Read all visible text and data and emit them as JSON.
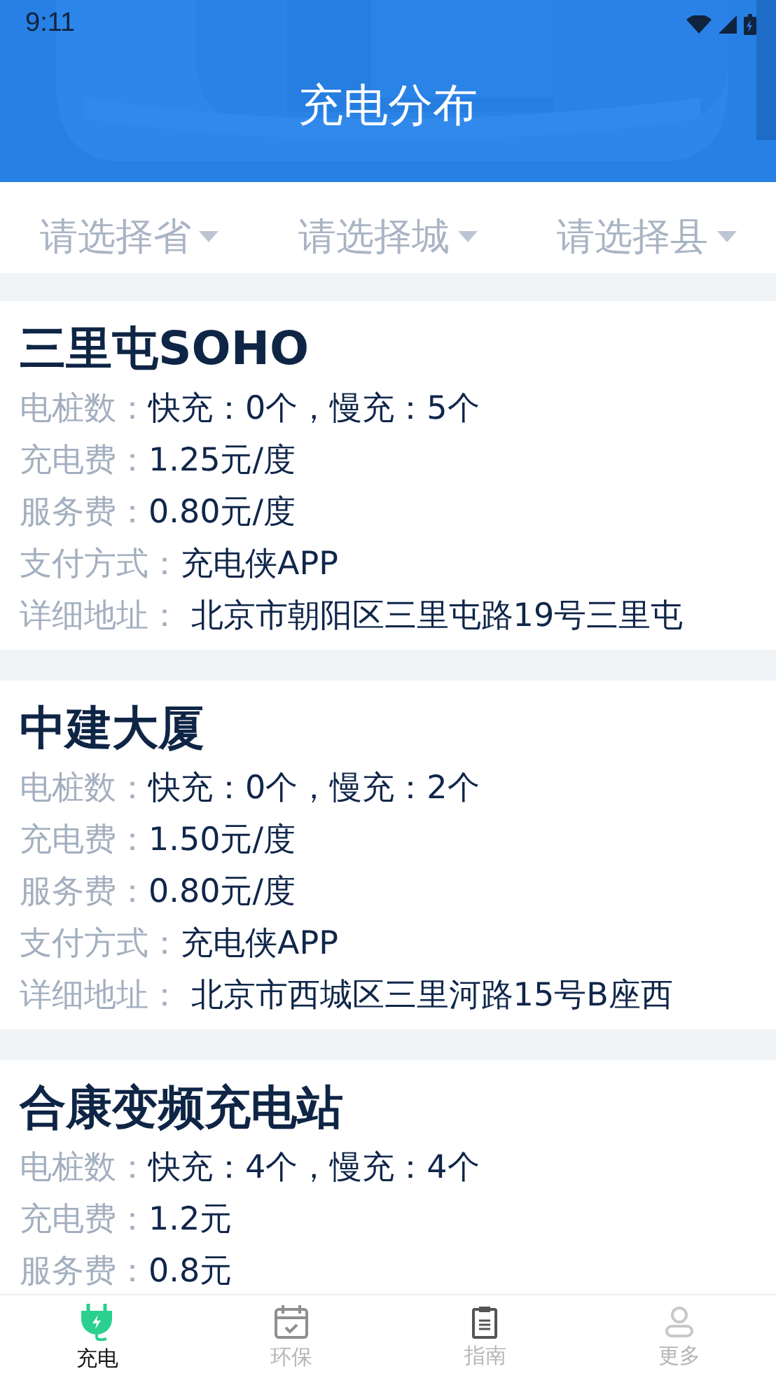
{
  "status_bar": {
    "time": "9:11"
  },
  "header": {
    "title": "充电分布"
  },
  "filters": [
    {
      "placeholder": "请选择省"
    },
    {
      "placeholder": "请选择城"
    },
    {
      "placeholder": "请选择县"
    }
  ],
  "stations": [
    {
      "name": "三里屯SOHO",
      "fields": [
        {
          "label": "电桩数：",
          "value": "快充：0个，慢充：5个"
        },
        {
          "label": "充电费：",
          "value": "1.25元/度"
        },
        {
          "label": "服务费：",
          "value": "0.80元/度"
        },
        {
          "label": "支付方式：",
          "value": "充电侠APP"
        },
        {
          "label": "详细地址：",
          "value": " 北京市朝阳区三里屯路19号三里屯"
        }
      ]
    },
    {
      "name": "中建大厦",
      "fields": [
        {
          "label": "电桩数：",
          "value": "快充：0个，慢充：2个"
        },
        {
          "label": "充电费：",
          "value": "1.50元/度"
        },
        {
          "label": "服务费：",
          "value": "0.80元/度"
        },
        {
          "label": "支付方式：",
          "value": "充电侠APP"
        },
        {
          "label": "详细地址：",
          "value": " 北京市西城区三里河路15号B座西"
        }
      ]
    },
    {
      "name": "合康变频充电站",
      "fields": [
        {
          "label": "电桩数：",
          "value": "快充：4个，慢充：4个"
        },
        {
          "label": "充电费：",
          "value": "1.2元"
        },
        {
          "label": "服务费：",
          "value": "0.8元"
        }
      ]
    }
  ],
  "nav": [
    {
      "label": "充电",
      "kind": "plug",
      "selected": true
    },
    {
      "label": "环保",
      "kind": "calendar",
      "selected": false
    },
    {
      "label": "指南",
      "kind": "clipboard",
      "selected": false
    },
    {
      "label": "更多",
      "kind": "person",
      "selected": false
    }
  ]
}
